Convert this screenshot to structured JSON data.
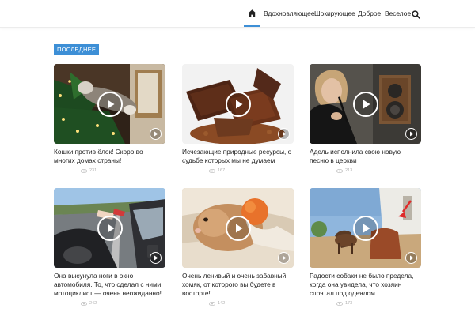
{
  "nav": {
    "home_icon": "home-icon",
    "items": [
      {
        "label": "Вдохновляющее"
      },
      {
        "label": "Шокирующее"
      },
      {
        "label": "Доброе"
      },
      {
        "label": "Веселое"
      }
    ],
    "search_icon": "search-icon",
    "active_color": "#3d8fd6"
  },
  "section": {
    "label": "ПОСЛЕДНЕЕ",
    "accent_color": "#3d8fd6"
  },
  "cards": [
    {
      "title": "Кошки против ёлок! Скоро во многих домах страны!",
      "views": "231"
    },
    {
      "title": "Исчезающие природные ресурсы, о судьбе которых мы не думаем",
      "views": "167"
    },
    {
      "title": "Адель исполнила свою новую песню в церкви",
      "views": "213"
    },
    {
      "title": "Она высунула ноги в окно автомобиля. То, что сделал с ними мотоциклист — очень неожиданно!",
      "views": "242"
    },
    {
      "title": "Очень ленивый и очень забавный хомяк, от которого вы будете в восторге!",
      "views": "142"
    },
    {
      "title": "Радости собаки не было предела, когда она увидела, что хозяин спрятал под одеялом",
      "views": "173"
    }
  ],
  "icons": {
    "play": "play-icon",
    "views": "eye-icon"
  }
}
